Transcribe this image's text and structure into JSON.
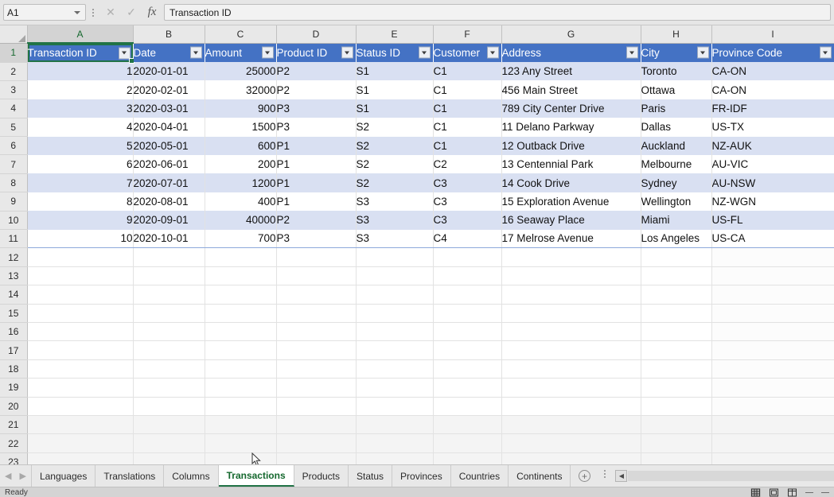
{
  "formula_bar": {
    "name_box_value": "A1",
    "cancel_icon": "close-icon",
    "confirm_icon": "check-icon",
    "function_icon": "fx-icon",
    "formula_value": "Transaction ID"
  },
  "grid": {
    "column_letters": [
      "A",
      "B",
      "C",
      "D",
      "E",
      "F",
      "G",
      "H",
      "I"
    ],
    "selected_column": "A",
    "selected_row": "1",
    "table_headers": [
      "Transaction ID",
      "Date",
      "Amount",
      "Product ID",
      "Status ID",
      "Customer",
      "Address",
      "City",
      "Province Code"
    ],
    "header_fill": "#4472C4",
    "band_fill": "#D9E0F2",
    "rows": [
      {
        "row_number": "2",
        "cells": [
          "1",
          "2020-01-01",
          "25000",
          "P2",
          "S1",
          "C1",
          "123 Any Street",
          "Toronto",
          "CA-ON"
        ]
      },
      {
        "row_number": "3",
        "cells": [
          "2",
          "2020-02-01",
          "32000",
          "P2",
          "S1",
          "C1",
          "456 Main Street",
          "Ottawa",
          "CA-ON"
        ]
      },
      {
        "row_number": "4",
        "cells": [
          "3",
          "2020-03-01",
          "900",
          "P3",
          "S1",
          "C1",
          "789 City Center Drive",
          "Paris",
          "FR-IDF"
        ]
      },
      {
        "row_number": "5",
        "cells": [
          "4",
          "2020-04-01",
          "1500",
          "P3",
          "S2",
          "C1",
          "11 Delano Parkway",
          "Dallas",
          "US-TX"
        ]
      },
      {
        "row_number": "6",
        "cells": [
          "5",
          "2020-05-01",
          "600",
          "P1",
          "S2",
          "C1",
          "12 Outback Drive",
          "Auckland",
          "NZ-AUK"
        ]
      },
      {
        "row_number": "7",
        "cells": [
          "6",
          "2020-06-01",
          "200",
          "P1",
          "S2",
          "C2",
          "13 Centennial Park",
          "Melbourne",
          "AU-VIC"
        ]
      },
      {
        "row_number": "8",
        "cells": [
          "7",
          "2020-07-01",
          "1200",
          "P1",
          "S2",
          "C3",
          "14 Cook Drive",
          "Sydney",
          "AU-NSW"
        ]
      },
      {
        "row_number": "9",
        "cells": [
          "8",
          "2020-08-01",
          "400",
          "P1",
          "S3",
          "C3",
          "15 Exploration Avenue",
          "Wellington",
          "NZ-WGN"
        ]
      },
      {
        "row_number": "10",
        "cells": [
          "9",
          "2020-09-01",
          "40000",
          "P2",
          "S3",
          "C3",
          "16 Seaway Place",
          "Miami",
          "US-FL"
        ]
      },
      {
        "row_number": "11",
        "cells": [
          "10",
          "2020-10-01",
          "700",
          "P3",
          "S3",
          "C4",
          "17 Melrose Avenue",
          "Los Angeles",
          "US-CA"
        ]
      }
    ],
    "empty_row_numbers": [
      "12",
      "13",
      "14",
      "15",
      "16",
      "17",
      "18",
      "19",
      "20",
      "21",
      "22",
      "23"
    ]
  },
  "sheet_tabs": {
    "prev_icon": "chevron-left-icon",
    "next_icon": "chevron-right-icon",
    "items": [
      "Languages",
      "Translations",
      "Columns",
      "Transactions",
      "Products",
      "Status",
      "Provinces",
      "Countries",
      "Continents"
    ],
    "active": "Transactions",
    "add_sheet_label": "+",
    "scroll_left_icon": "scroll-left-icon"
  },
  "status_bar": {
    "status_text": "Ready",
    "view_normal": "normal-view-icon",
    "view_page_layout": "page-layout-view-icon",
    "view_page_break": "page-break-view-icon"
  }
}
